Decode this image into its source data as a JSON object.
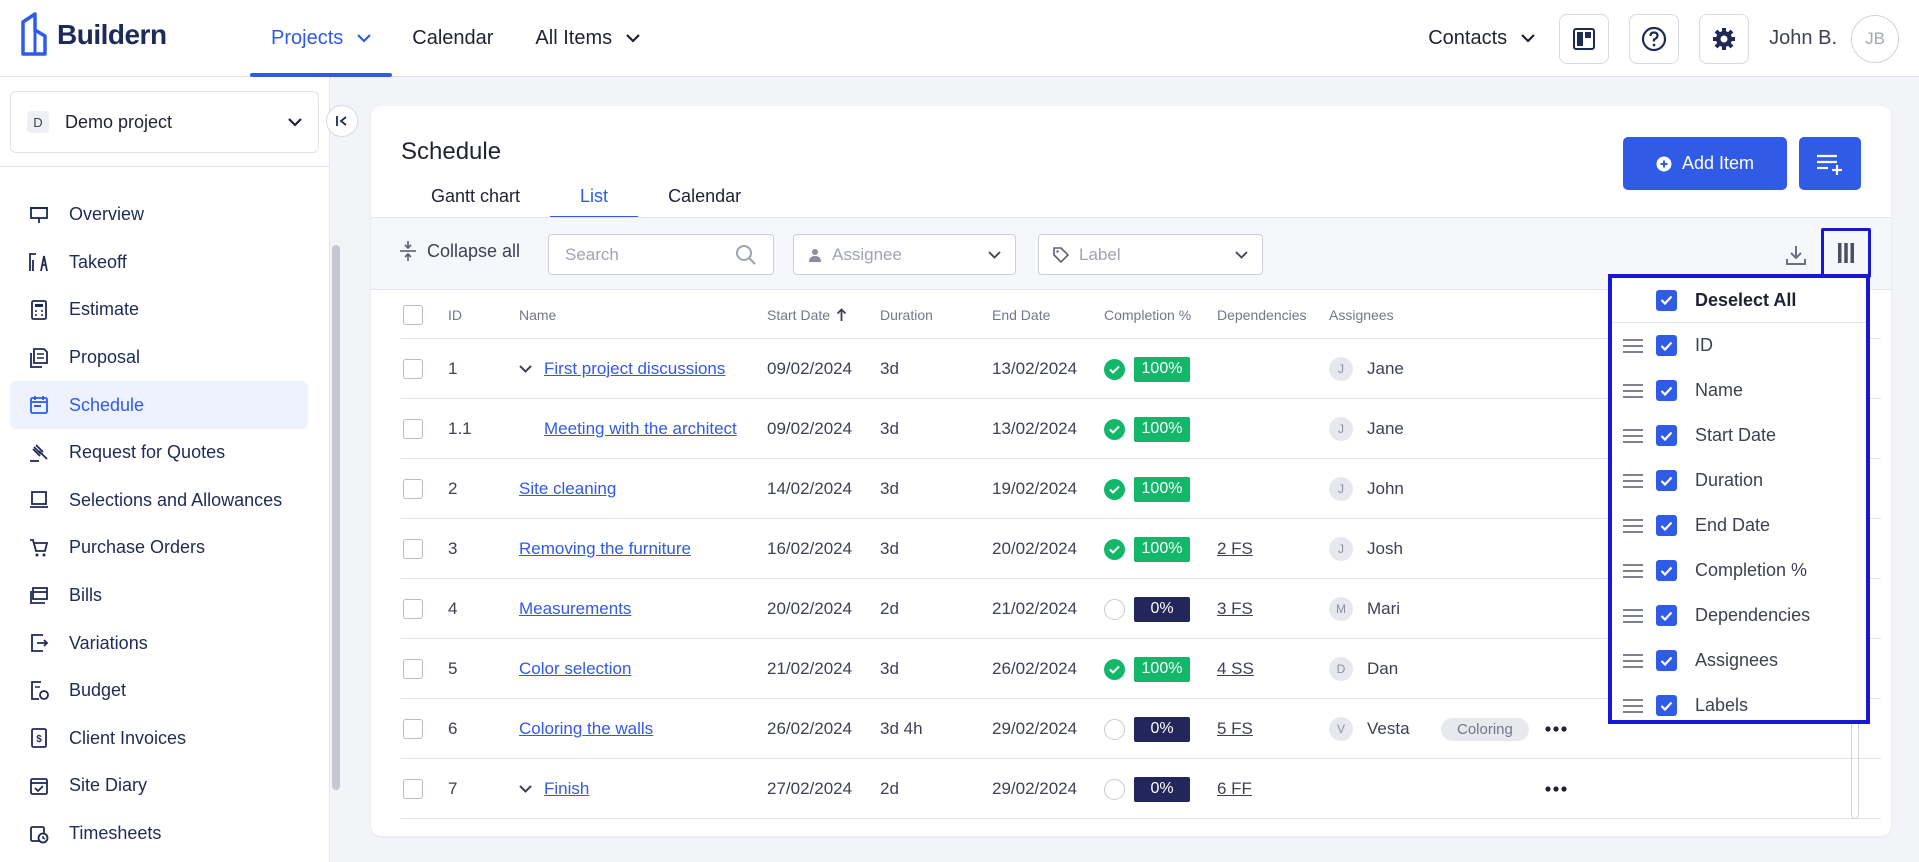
{
  "brand": {
    "name": "Buildern"
  },
  "nav": {
    "items": [
      {
        "label": "Projects",
        "has_dropdown": true,
        "active": true
      },
      {
        "label": "Calendar",
        "has_dropdown": false,
        "active": false
      },
      {
        "label": "All Items",
        "has_dropdown": true,
        "active": false
      }
    ],
    "contacts_label": "Contacts",
    "user_name": "John B.",
    "user_initials": "JB"
  },
  "sidebar": {
    "project_badge": "D",
    "project_name": "Demo project",
    "items": [
      {
        "label": "Overview",
        "icon": "presentation-icon"
      },
      {
        "label": "Takeoff",
        "icon": "takeoff-icon"
      },
      {
        "label": "Estimate",
        "icon": "calculator-icon"
      },
      {
        "label": "Proposal",
        "icon": "proposal-icon"
      },
      {
        "label": "Schedule",
        "icon": "calendar-icon",
        "active": true
      },
      {
        "label": "Request for Quotes",
        "icon": "gavel-icon"
      },
      {
        "label": "Selections and Allowances",
        "icon": "selections-icon"
      },
      {
        "label": "Purchase Orders",
        "icon": "cart-icon"
      },
      {
        "label": "Bills",
        "icon": "bills-icon"
      },
      {
        "label": "Variations",
        "icon": "variations-icon"
      },
      {
        "label": "Budget",
        "icon": "budget-icon"
      },
      {
        "label": "Client Invoices",
        "icon": "invoice-icon"
      },
      {
        "label": "Site Diary",
        "icon": "diary-icon"
      },
      {
        "label": "Timesheets",
        "icon": "timesheet-icon"
      }
    ]
  },
  "main": {
    "title": "Schedule",
    "tabs": [
      "Gantt chart",
      "List",
      "Calendar"
    ],
    "active_tab": "List",
    "add_item_label": "Add Item",
    "toolbar": {
      "collapse_all": "Collapse all",
      "search_placeholder": "Search",
      "assignee_placeholder": "Assignee",
      "label_placeholder": "Label"
    },
    "columns": [
      "ID",
      "Name",
      "Start Date",
      "Duration",
      "End Date",
      "Completion %",
      "Dependencies",
      "Assignees"
    ],
    "sort": {
      "column": "Start Date",
      "direction": "asc"
    },
    "rows": [
      {
        "id": "1",
        "name": "First project discussions",
        "expandable": true,
        "start": "09/02/2024",
        "duration": "3d",
        "end": "13/02/2024",
        "completion": "100%",
        "done": true,
        "deps": "",
        "assignee_initial": "J",
        "assignee": "Jane",
        "label": "",
        "more": false
      },
      {
        "id": "1.1",
        "name": "Meeting with the architect",
        "indent": true,
        "start": "09/02/2024",
        "duration": "3d",
        "end": "13/02/2024",
        "completion": "100%",
        "done": true,
        "deps": "",
        "assignee_initial": "J",
        "assignee": "Jane",
        "label": "",
        "more": false
      },
      {
        "id": "2",
        "name": "Site cleaning",
        "start": "14/02/2024",
        "duration": "3d",
        "end": "19/02/2024",
        "completion": "100%",
        "done": true,
        "deps": "",
        "assignee_initial": "J",
        "assignee": "John",
        "label": "",
        "more": false
      },
      {
        "id": "3",
        "name": "Removing the furniture",
        "start": "16/02/2024",
        "duration": "3d",
        "end": "20/02/2024",
        "completion": "100%",
        "done": true,
        "deps": "2 FS",
        "assignee_initial": "J",
        "assignee": "Josh",
        "label": "",
        "more": false
      },
      {
        "id": "4",
        "name": "Measurements",
        "start": "20/02/2024",
        "duration": "2d",
        "end": "21/02/2024",
        "completion": "0%",
        "done": false,
        "deps": "3 FS",
        "assignee_initial": "M",
        "assignee": "Mari",
        "label": "",
        "more": false
      },
      {
        "id": "5",
        "name": "Color selection",
        "start": "21/02/2024",
        "duration": "3d",
        "end": "26/02/2024",
        "completion": "100%",
        "done": true,
        "deps": "4 SS",
        "assignee_initial": "D",
        "assignee": "Dan",
        "label": "",
        "more": false
      },
      {
        "id": "6",
        "name": "Coloring the walls",
        "start": "26/02/2024",
        "duration": "3d 4h",
        "end": "29/02/2024",
        "completion": "0%",
        "done": false,
        "deps": "5 FS",
        "assignee_initial": "V",
        "assignee": "Vesta",
        "label": "Coloring",
        "more": true
      },
      {
        "id": "7",
        "name": "Finish",
        "expandable": true,
        "start": "27/02/2024",
        "duration": "2d",
        "end": "29/02/2024",
        "completion": "0%",
        "done": false,
        "deps": "6 FF",
        "assignee_initial": "",
        "assignee": "",
        "label": "",
        "more": true
      }
    ]
  },
  "columns_menu": {
    "deselect_all": "Deselect All",
    "items": [
      "ID",
      "Name",
      "Start Date",
      "Duration",
      "End Date",
      "Completion %",
      "Dependencies",
      "Assignees",
      "Labels"
    ]
  },
  "colors": {
    "accent": "#2f5be7",
    "success": "#12b76a",
    "dark": "#22265a",
    "highlight": "#1717d4"
  }
}
